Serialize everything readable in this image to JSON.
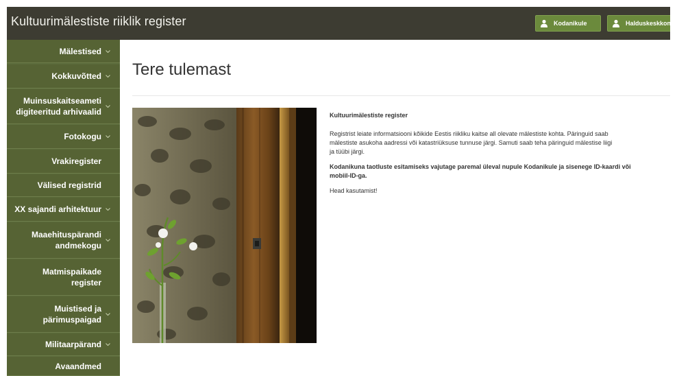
{
  "app": {
    "title": "Kultuurimälestiste riiklik register"
  },
  "header": {
    "buttons": [
      {
        "label": "Kodanikule",
        "icon": "person-icon"
      },
      {
        "label": "Halduskeskkond",
        "icon": "person-icon"
      }
    ]
  },
  "sidebar": {
    "items": [
      {
        "label": "Mälestised",
        "chevron": true
      },
      {
        "label": "Kokkuvõtted",
        "chevron": true
      },
      {
        "label": "Muinsuskaitseameti\ndigiteeritud arhivaalid",
        "chevron": true
      },
      {
        "label": "Fotokogu",
        "chevron": true
      },
      {
        "label": "Vrakiregister",
        "chevron": false
      },
      {
        "label": "Välised registrid",
        "chevron": false
      },
      {
        "label": "XX sajandi arhitektuur",
        "chevron": true
      },
      {
        "label": "Maaehituspärandi\nandmekogu",
        "chevron": true
      },
      {
        "label": "Matmispaikade\nregister",
        "chevron": false
      },
      {
        "label": "Muistised ja\npärimuspaigad",
        "chevron": true
      },
      {
        "label": "Militaarpärand",
        "chevron": true
      },
      {
        "label": "Avaandmed",
        "chevron": false
      }
    ]
  },
  "main": {
    "title": "Tere tulemast",
    "heading": "Kultuurimälestiste register",
    "paragraph1_lines": [
      "Registrist leiate informatsiooni kõikide Eestis riikliku kaitse all olevate mälestiste kohta.  Päringuid saab",
      "mälestiste asukoha aadressi või katastriüksuse tunnuse järgi. Samuti saab teha päringuid mälestise liigi",
      "ja tüübi järgi."
    ],
    "paragraph2_lines": [
      "Kodanikuna taotluste esitamiseks vajutage paremal üleval nupule Kodanikule ja sisenege ID-kaardi või",
      "mobiil-ID-ga."
    ],
    "closing": "Head kasutamist!"
  },
  "colors": {
    "topbar": "#3d3c32",
    "sidebar": "#566334",
    "button": "#6b8a3c"
  }
}
